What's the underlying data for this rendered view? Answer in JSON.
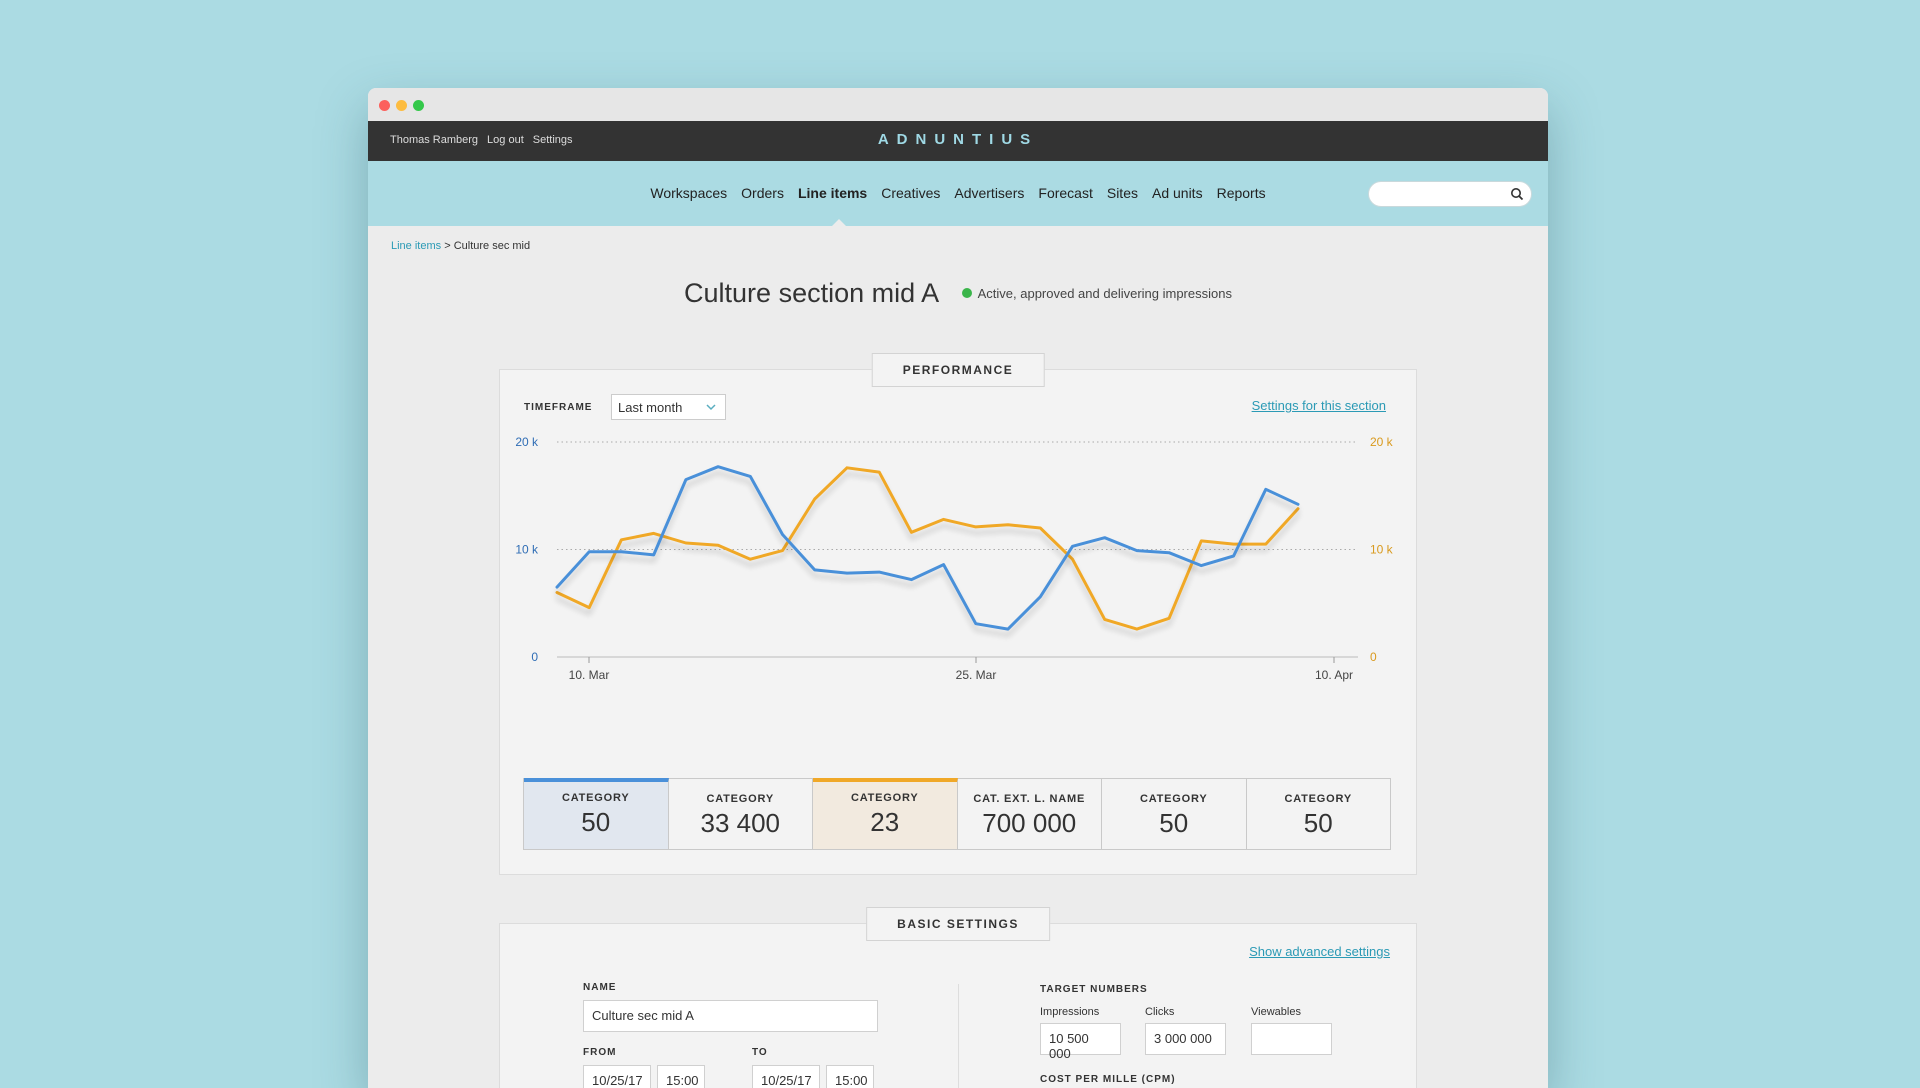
{
  "topbar": {
    "user_name": "Thomas Ramberg",
    "logout": "Log out",
    "settings": "Settings",
    "logo": "ADNUNTIUS"
  },
  "nav": {
    "items": [
      "Workspaces",
      "Orders",
      "Line items",
      "Creatives",
      "Advertisers",
      "Forecast",
      "Sites",
      "Ad units",
      "Reports"
    ],
    "active": "Line items",
    "search_placeholder": ""
  },
  "breadcrumb": {
    "parent": "Line items",
    "separator": ">",
    "current": "Culture sec mid"
  },
  "page": {
    "title": "Culture section mid A",
    "status": "Active, approved and delivering impressions",
    "status_color": "#3ab54a"
  },
  "performance": {
    "tab_label": "PERFORMANCE",
    "timeframe_label": "TIMEFRAME",
    "timeframe_value": "Last month",
    "settings_link": "Settings for this section"
  },
  "chart_data": {
    "type": "line",
    "x": [
      7,
      8,
      9,
      10,
      11,
      12,
      13,
      14,
      15,
      16,
      17,
      18,
      19,
      20,
      21,
      22,
      23,
      24,
      25,
      26,
      27,
      28,
      29,
      30,
      31,
      32,
      33,
      34
    ],
    "x_tick_labels": [
      "10. Mar",
      "25. Mar",
      "10. Apr"
    ],
    "y_tick_labels_left": [
      "0",
      "10 k",
      "20 k"
    ],
    "y_tick_labels_right": [
      "0",
      "10 k",
      "20 k"
    ],
    "ylim": [
      0,
      20000
    ],
    "grid": "dotted at 10 k and 20 k",
    "series": [
      {
        "color": "#4a90d9",
        "values": [
          6500,
          9800,
          9800,
          9500,
          16500,
          17700,
          16800,
          11400,
          8100,
          7800,
          7900,
          7200,
          8600,
          3100,
          2600,
          5600,
          10300,
          11100,
          9900,
          9700,
          8500,
          9400,
          15600,
          14200
        ]
      },
      {
        "color": "#f0a828",
        "values": [
          6000,
          4600,
          10900,
          11500,
          10600,
          10400,
          9100,
          9900,
          14700,
          17600,
          17200,
          11600,
          12800,
          12100,
          12300,
          12000,
          9100,
          3500,
          2600,
          3600,
          10800,
          10500,
          10500,
          13800
        ]
      }
    ],
    "categories_summary": [
      {
        "label": "CATEGORY",
        "value": "50",
        "selected": "blue"
      },
      {
        "label": "CATEGORY",
        "value": "33 400",
        "selected": ""
      },
      {
        "label": "CATEGORY",
        "value": "23",
        "selected": "orange"
      },
      {
        "label": "CAT. EXT. L. NAME",
        "value": "700 000",
        "selected": ""
      },
      {
        "label": "CATEGORY",
        "value": "50",
        "selected": ""
      },
      {
        "label": "CATEGORY",
        "value": "50",
        "selected": ""
      }
    ]
  },
  "basic": {
    "tab_label": "BASIC SETTINGS",
    "advanced_link": "Show advanced settings",
    "name_label": "NAME",
    "name_value": "Culture sec mid A",
    "from_label": "FROM",
    "to_label": "TO",
    "from_date": "10/25/17",
    "from_time": "15:00",
    "to_date": "10/25/17",
    "to_time": "15:00",
    "target_label": "TARGET NUMBERS",
    "impressions_label": "Impressions",
    "impressions_value": "10 500 000",
    "clicks_label": "Clicks",
    "clicks_value": "3 000 000",
    "viewables_label": "Viewables",
    "viewables_value": "",
    "cpm_label": "COST PER MILLE (CPM)"
  }
}
